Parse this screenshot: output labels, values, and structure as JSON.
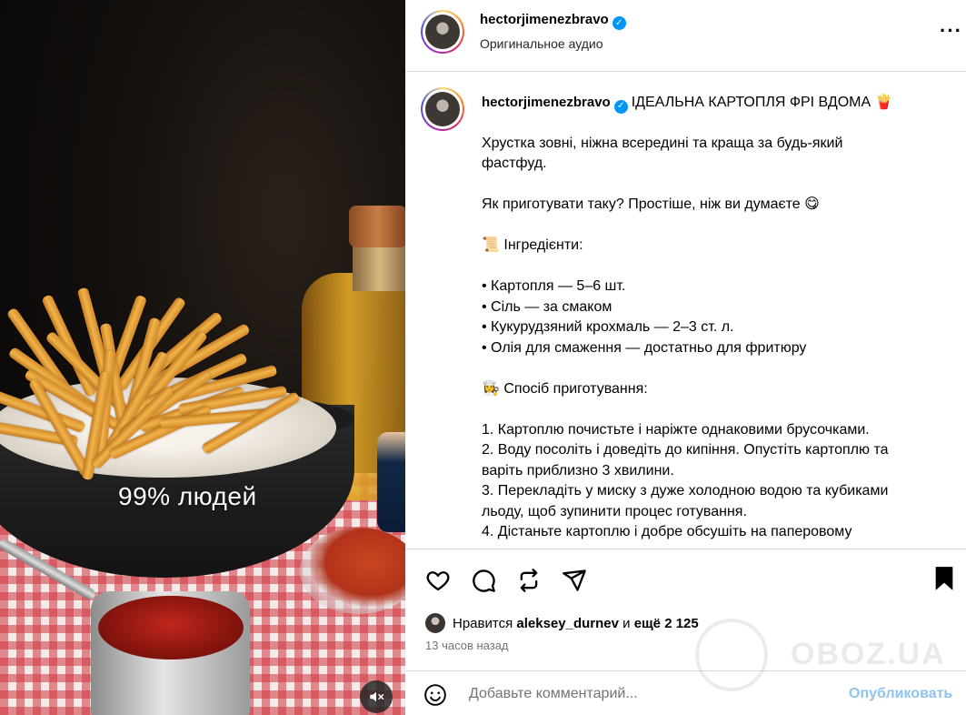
{
  "media": {
    "overlay_text": "99% людей",
    "mute_icon": "volume-muted-icon"
  },
  "header": {
    "username": "hectorjimenezbravo",
    "verified": true,
    "audio_label": "Оригинальное аудио",
    "more_icon": "more-horizontal-icon"
  },
  "caption": {
    "username": "hectorjimenezbravo",
    "title": "ІДЕАЛЬНА КАРТОПЛЯ ФРІ ВДОМА 🍟",
    "lines": [
      "Хрустка зовні, ніжна всередині та краща за будь-який",
      "фастфуд.",
      "",
      "Як приготувати таку? Простіше, ніж ви думаєте 😋",
      "",
      "📜 Інгредієнти:",
      "",
      "• Картопля — 5–6 шт.",
      "• Сіль — за смаком",
      "• Кукурудзяний крохмаль — 2–3 ст. л.",
      "• Олія для смаження — достатньо для фритюру",
      "",
      "👩‍🍳 Спосіб приготування:",
      "",
      "1. Картоплю почистьте і наріжте однаковими брусочками.",
      "2. Воду посоліть і доведіть до кипіння. Опустіть картоплю та",
      "варіть приблизно 3 хвилини.",
      "3. Перекладіть у миску з дуже холодною водою та кубиками",
      "льоду, щоб зупинити процес готування.",
      "4. Дістаньте картоплю і добре обсушіть на паперовому"
    ]
  },
  "actions": {
    "icons": [
      "heart-icon",
      "comment-icon",
      "repost-icon",
      "share-icon"
    ],
    "bookmark_icon": "bookmark-icon"
  },
  "likes": {
    "prefix": "Нравится",
    "user": "aleksey_durnev",
    "middle": "и",
    "rest": "ещё 2 125"
  },
  "time_ago": "13 часов назад",
  "comment": {
    "placeholder": "Добавьте комментарий...",
    "publish_label": "Опубликовать",
    "emoji_icon": "smiley-icon"
  },
  "watermark": "OBOZ.UA",
  "colors": {
    "verified": "#0095f6",
    "publish_disabled": "#8fc3f0",
    "secondary_text": "#737373",
    "divider": "#dbdbdb"
  }
}
